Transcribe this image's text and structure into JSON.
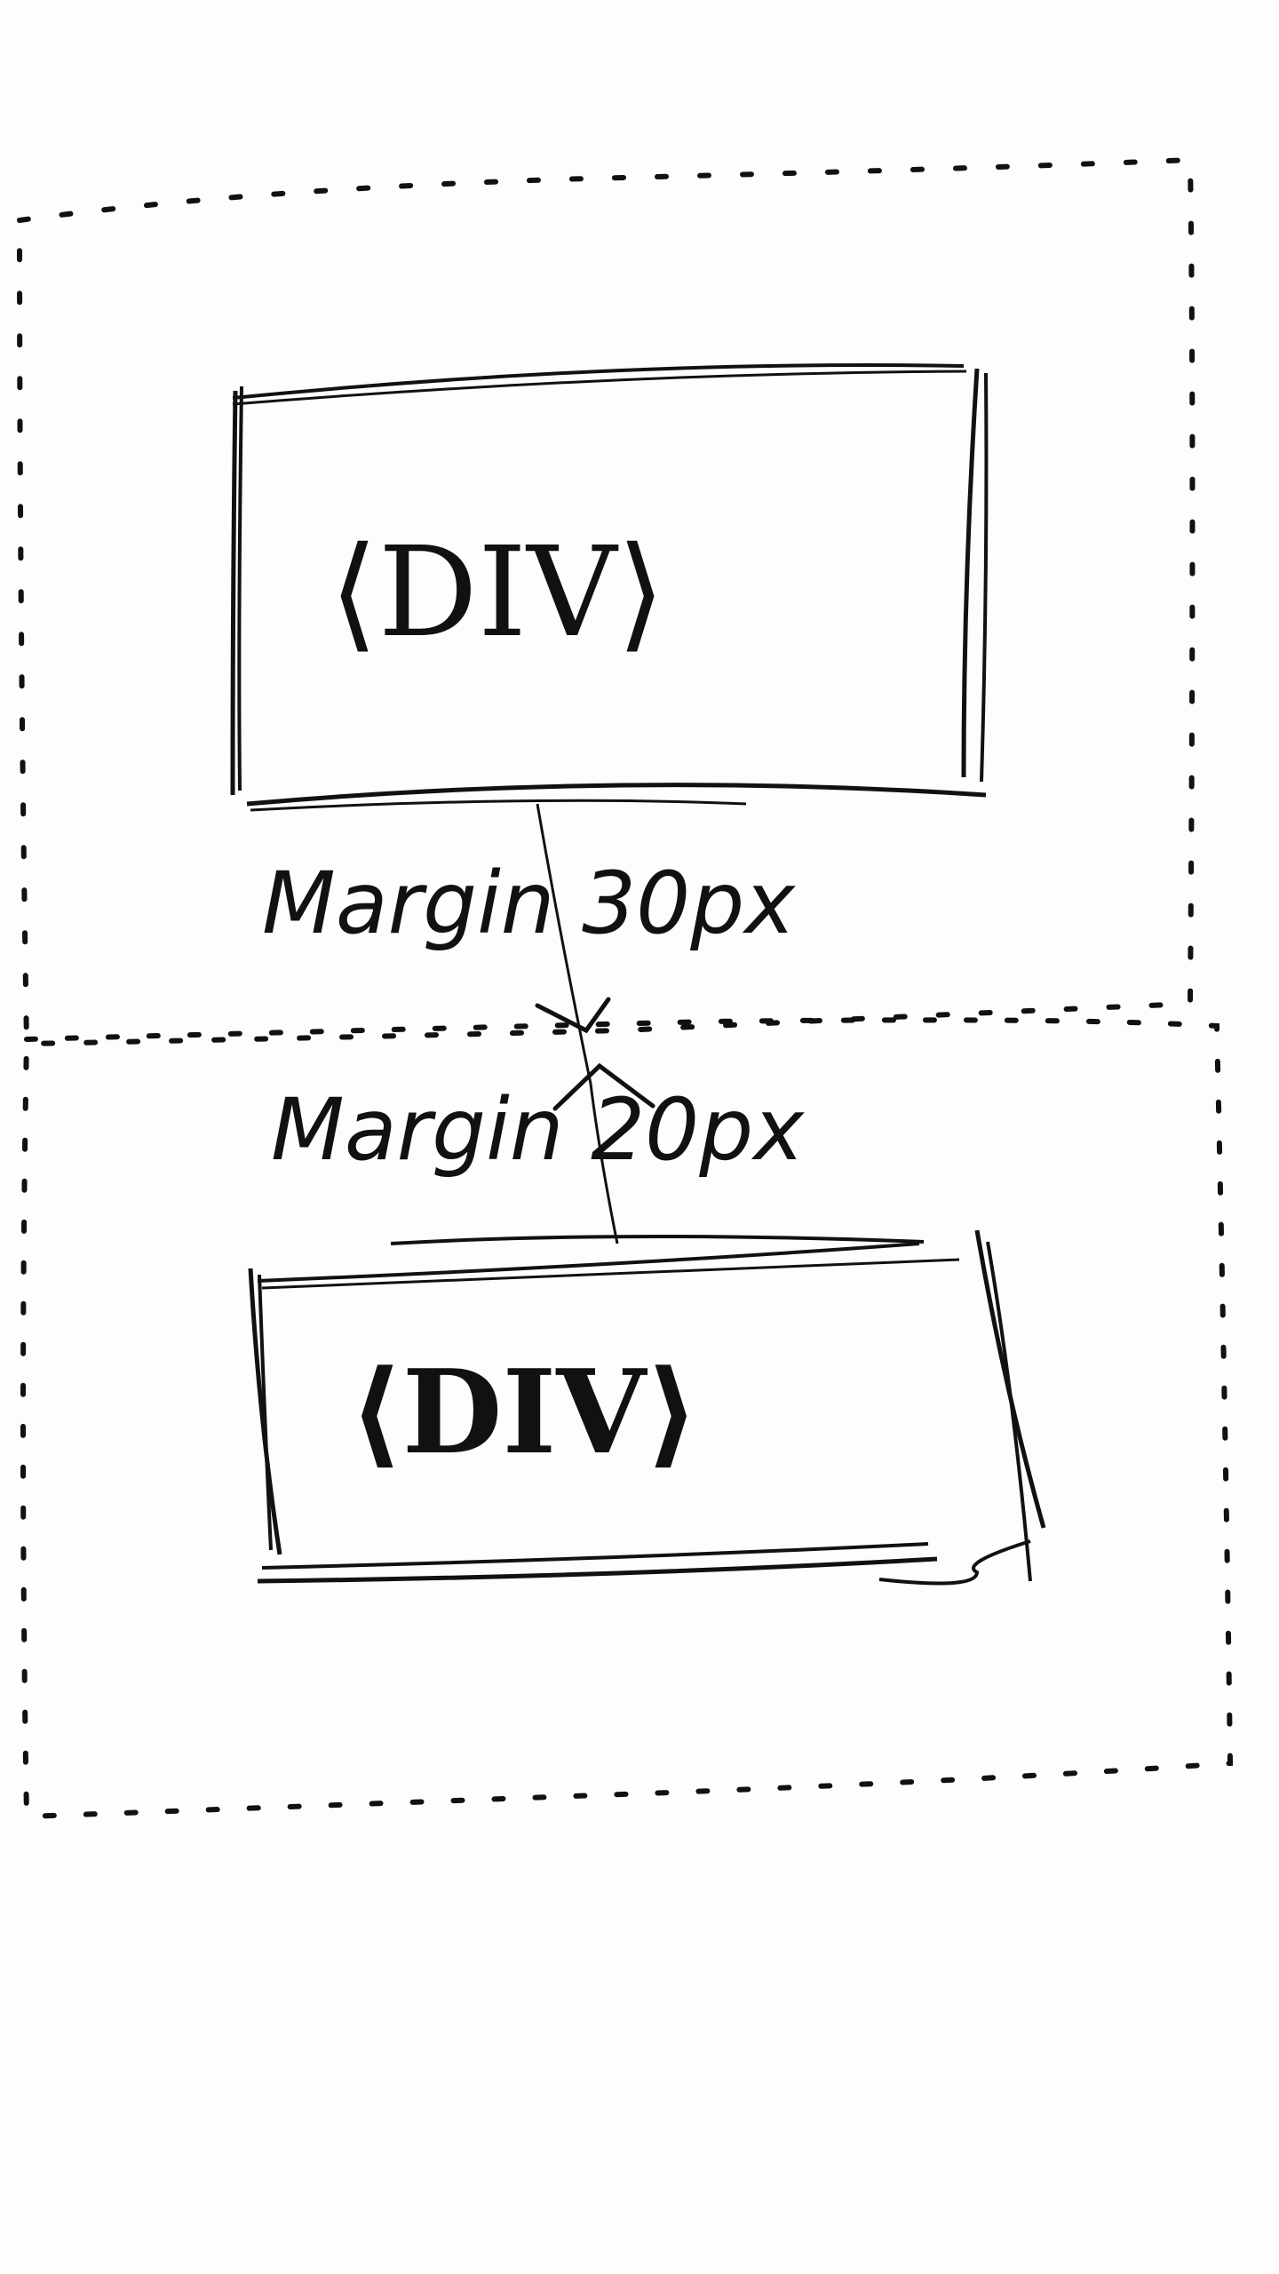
{
  "diagram": {
    "top_box": {
      "label": "⟨DIV⟩"
    },
    "bottom_box": {
      "label": "⟨DIV⟩"
    },
    "margin_top_label": "Margin 30px",
    "margin_bottom_label": "Margin 20px"
  }
}
